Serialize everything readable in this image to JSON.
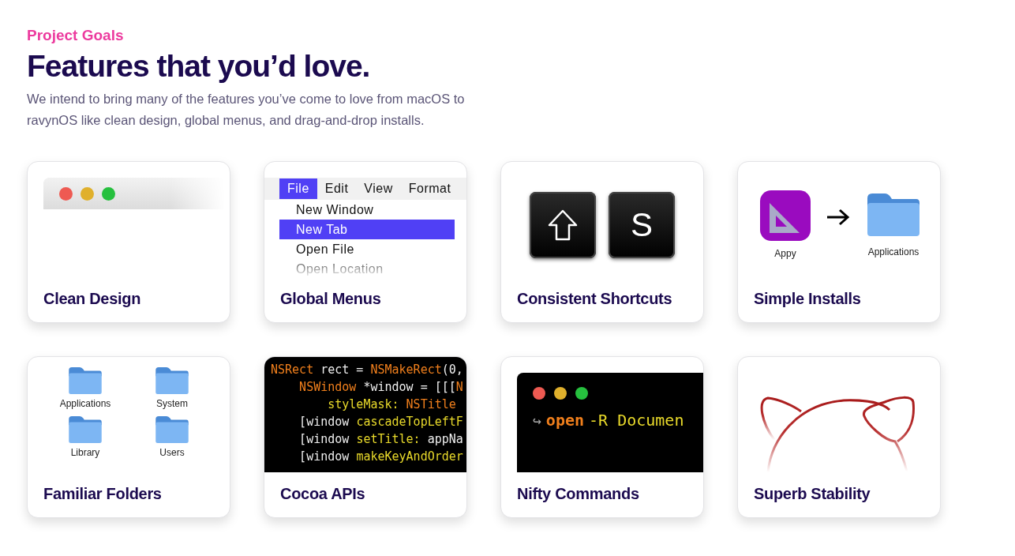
{
  "header": {
    "eyebrow": "Project Goals",
    "title": "Features that you’d love.",
    "intro": "We intend to bring many of the features you’ve come to love from macOS to ravynOS like clean design, global menus, and drag-and-drop installs."
  },
  "cards": [
    {
      "kind": "window",
      "title": "Clean Design"
    },
    {
      "kind": "menu",
      "title": "Global Menus",
      "menubar": [
        {
          "label": "File",
          "selected": true
        },
        {
          "label": "Edit",
          "selected": false
        },
        {
          "label": "View",
          "selected": false
        },
        {
          "label": "Format",
          "selected": false
        }
      ],
      "items": [
        {
          "label": "New Window",
          "selected": false
        },
        {
          "label": "New Tab",
          "selected": true
        },
        {
          "label": "Open File",
          "selected": false
        },
        {
          "label": "Open Location",
          "selected": false
        }
      ]
    },
    {
      "kind": "keys",
      "title": "Consistent Shortcuts",
      "keys": [
        {
          "kind": "shift"
        },
        {
          "kind": "letter",
          "label": "S"
        }
      ]
    },
    {
      "kind": "install",
      "title": "Simple Installs",
      "app": "Appy",
      "target": "Applications"
    },
    {
      "kind": "folders",
      "title": "Familiar Folders",
      "folders": [
        "Applications",
        "System",
        "Library",
        "Users"
      ]
    },
    {
      "kind": "code",
      "title": "Cocoa APIs",
      "lines": [
        [
          {
            "text": "NSRect",
            "kind": "type"
          },
          {
            "text": " rect = ",
            "kind": "plain"
          },
          {
            "text": "NSMakeRect",
            "kind": "type"
          },
          {
            "text": "(0,",
            "kind": "plain"
          }
        ],
        [
          {
            "text": "    NSWindow",
            "kind": "type"
          },
          {
            "text": " *window = [[[",
            "kind": "plain"
          },
          {
            "text": "N",
            "kind": "type"
          }
        ],
        [
          {
            "text": "        styleMask: ",
            "kind": "method"
          },
          {
            "text": "NSTitle",
            "kind": "type"
          }
        ],
        [
          {
            "text": "    [window ",
            "kind": "plain"
          },
          {
            "text": "cascadeTopLeftF",
            "kind": "method"
          }
        ],
        [
          {
            "text": "    [window ",
            "kind": "plain"
          },
          {
            "text": "setTitle:",
            "kind": "method"
          },
          {
            "text": " appNa",
            "kind": "plain"
          }
        ],
        [
          {
            "text": "    [window ",
            "kind": "plain"
          },
          {
            "text": "makeKeyAndOrder",
            "kind": "method"
          }
        ]
      ]
    },
    {
      "kind": "terminal",
      "title": "Nifty Commands",
      "prompt": "↪",
      "command": "open",
      "args": "-R Documen"
    },
    {
      "kind": "logo",
      "title": "Superb Stability"
    }
  ]
}
